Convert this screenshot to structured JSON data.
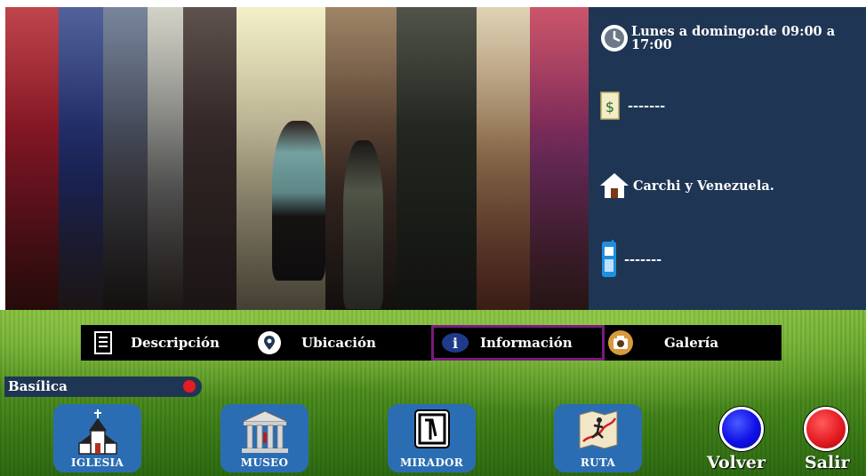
{
  "info_panel": {
    "hours": "Lunes a domingo:de 09:00 a 17:00",
    "price": "-------",
    "address": "Carchi y Venezuela.",
    "phone": "-------"
  },
  "menu": {
    "items": [
      {
        "label": "Descripción",
        "icon": "document-icon"
      },
      {
        "label": "Ubicación",
        "icon": "location-pin-icon"
      },
      {
        "label": "Información",
        "icon": "info-icon",
        "active": true
      },
      {
        "label": "Galería",
        "icon": "camera-icon"
      }
    ]
  },
  "place_tag": {
    "label": "Basílica"
  },
  "nav_buttons": [
    {
      "label": "IGLESIA",
      "icon": "church-icon"
    },
    {
      "label": "MUSEO",
      "icon": "museum-icon"
    },
    {
      "label": "MIRADOR",
      "icon": "lookout-icon"
    },
    {
      "label": "RUTA",
      "icon": "route-map-icon"
    }
  ],
  "actions": {
    "back_label": "Volver",
    "exit_label": "Salir"
  },
  "colors": {
    "panel": "#1f3554",
    "menu_bar": "#000000",
    "active_border": "#7a1a7e",
    "nav_button": "#2b6db3",
    "back_button": "#1a1aff",
    "exit_button": "#e51c23"
  }
}
